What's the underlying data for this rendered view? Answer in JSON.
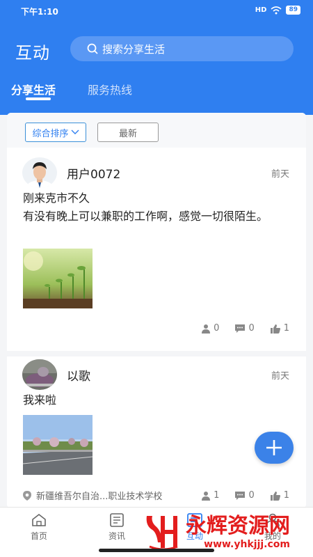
{
  "status_bar": {
    "time": "下午1:10",
    "signal": "HD",
    "battery": "89"
  },
  "header": {
    "title": "互动",
    "search_placeholder": "搜索分享生活",
    "tabs": [
      "分享生活",
      "服务热线"
    ]
  },
  "sort": {
    "comprehensive": "综合排序",
    "latest": "最新"
  },
  "posts": [
    {
      "username": "用户0072",
      "time": "前天",
      "content": "刚来克市不久\n有没有晚上可以兼职的工作啊，感觉一切很陌生。",
      "views": "0",
      "comments": "0",
      "likes": "1"
    },
    {
      "username": "以歌",
      "time": "前天",
      "content": "我来啦",
      "location": "新疆维吾尔自治...职业技术学校",
      "views": "1",
      "comments": "0",
      "likes": "1"
    }
  ],
  "nav": [
    "首页",
    "资讯",
    "互动",
    "我的"
  ],
  "watermark": {
    "text": "永辉资源网",
    "url": "www.yhkjjj.com"
  },
  "colors": {
    "primary": "#2f7ff0",
    "watermark": "#e31d1d"
  }
}
